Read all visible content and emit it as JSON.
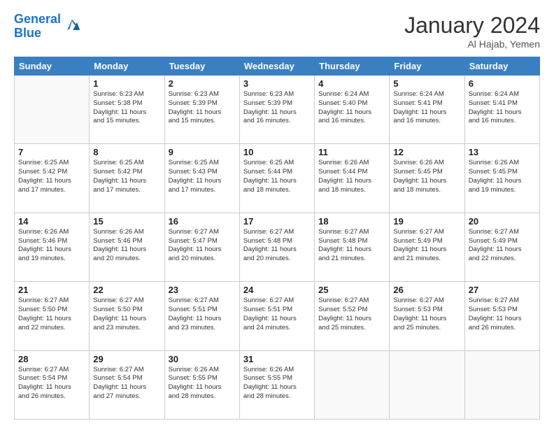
{
  "header": {
    "logo_line1": "General",
    "logo_line2": "Blue",
    "month": "January 2024",
    "location": "Al Hajab, Yemen"
  },
  "weekdays": [
    "Sunday",
    "Monday",
    "Tuesday",
    "Wednesday",
    "Thursday",
    "Friday",
    "Saturday"
  ],
  "weeks": [
    [
      {
        "day": "",
        "text": ""
      },
      {
        "day": "1",
        "text": "Sunrise: 6:23 AM\nSunset: 5:38 PM\nDaylight: 11 hours\nand 15 minutes."
      },
      {
        "day": "2",
        "text": "Sunrise: 6:23 AM\nSunset: 5:39 PM\nDaylight: 11 hours\nand 15 minutes."
      },
      {
        "day": "3",
        "text": "Sunrise: 6:23 AM\nSunset: 5:39 PM\nDaylight: 11 hours\nand 16 minutes."
      },
      {
        "day": "4",
        "text": "Sunrise: 6:24 AM\nSunset: 5:40 PM\nDaylight: 11 hours\nand 16 minutes."
      },
      {
        "day": "5",
        "text": "Sunrise: 6:24 AM\nSunset: 5:41 PM\nDaylight: 11 hours\nand 16 minutes."
      },
      {
        "day": "6",
        "text": "Sunrise: 6:24 AM\nSunset: 5:41 PM\nDaylight: 11 hours\nand 16 minutes."
      }
    ],
    [
      {
        "day": "7",
        "text": "Sunrise: 6:25 AM\nSunset: 5:42 PM\nDaylight: 11 hours\nand 17 minutes."
      },
      {
        "day": "8",
        "text": "Sunrise: 6:25 AM\nSunset: 5:42 PM\nDaylight: 11 hours\nand 17 minutes."
      },
      {
        "day": "9",
        "text": "Sunrise: 6:25 AM\nSunset: 5:43 PM\nDaylight: 11 hours\nand 17 minutes."
      },
      {
        "day": "10",
        "text": "Sunrise: 6:25 AM\nSunset: 5:44 PM\nDaylight: 11 hours\nand 18 minutes."
      },
      {
        "day": "11",
        "text": "Sunrise: 6:26 AM\nSunset: 5:44 PM\nDaylight: 11 hours\nand 18 minutes."
      },
      {
        "day": "12",
        "text": "Sunrise: 6:26 AM\nSunset: 5:45 PM\nDaylight: 11 hours\nand 18 minutes."
      },
      {
        "day": "13",
        "text": "Sunrise: 6:26 AM\nSunset: 5:45 PM\nDaylight: 11 hours\nand 19 minutes."
      }
    ],
    [
      {
        "day": "14",
        "text": "Sunrise: 6:26 AM\nSunset: 5:46 PM\nDaylight: 11 hours\nand 19 minutes."
      },
      {
        "day": "15",
        "text": "Sunrise: 6:26 AM\nSunset: 5:46 PM\nDaylight: 11 hours\nand 20 minutes."
      },
      {
        "day": "16",
        "text": "Sunrise: 6:27 AM\nSunset: 5:47 PM\nDaylight: 11 hours\nand 20 minutes."
      },
      {
        "day": "17",
        "text": "Sunrise: 6:27 AM\nSunset: 5:48 PM\nDaylight: 11 hours\nand 20 minutes."
      },
      {
        "day": "18",
        "text": "Sunrise: 6:27 AM\nSunset: 5:48 PM\nDaylight: 11 hours\nand 21 minutes."
      },
      {
        "day": "19",
        "text": "Sunrise: 6:27 AM\nSunset: 5:49 PM\nDaylight: 11 hours\nand 21 minutes."
      },
      {
        "day": "20",
        "text": "Sunrise: 6:27 AM\nSunset: 5:49 PM\nDaylight: 11 hours\nand 22 minutes."
      }
    ],
    [
      {
        "day": "21",
        "text": "Sunrise: 6:27 AM\nSunset: 5:50 PM\nDaylight: 11 hours\nand 22 minutes."
      },
      {
        "day": "22",
        "text": "Sunrise: 6:27 AM\nSunset: 5:50 PM\nDaylight: 11 hours\nand 23 minutes."
      },
      {
        "day": "23",
        "text": "Sunrise: 6:27 AM\nSunset: 5:51 PM\nDaylight: 11 hours\nand 23 minutes."
      },
      {
        "day": "24",
        "text": "Sunrise: 6:27 AM\nSunset: 5:51 PM\nDaylight: 11 hours\nand 24 minutes."
      },
      {
        "day": "25",
        "text": "Sunrise: 6:27 AM\nSunset: 5:52 PM\nDaylight: 11 hours\nand 25 minutes."
      },
      {
        "day": "26",
        "text": "Sunrise: 6:27 AM\nSunset: 5:53 PM\nDaylight: 11 hours\nand 25 minutes."
      },
      {
        "day": "27",
        "text": "Sunrise: 6:27 AM\nSunset: 5:53 PM\nDaylight: 11 hours\nand 26 minutes."
      }
    ],
    [
      {
        "day": "28",
        "text": "Sunrise: 6:27 AM\nSunset: 5:54 PM\nDaylight: 11 hours\nand 26 minutes."
      },
      {
        "day": "29",
        "text": "Sunrise: 6:27 AM\nSunset: 5:54 PM\nDaylight: 11 hours\nand 27 minutes."
      },
      {
        "day": "30",
        "text": "Sunrise: 6:26 AM\nSunset: 5:55 PM\nDaylight: 11 hours\nand 28 minutes."
      },
      {
        "day": "31",
        "text": "Sunrise: 6:26 AM\nSunset: 5:55 PM\nDaylight: 11 hours\nand 28 minutes."
      },
      {
        "day": "",
        "text": ""
      },
      {
        "day": "",
        "text": ""
      },
      {
        "day": "",
        "text": ""
      }
    ]
  ]
}
